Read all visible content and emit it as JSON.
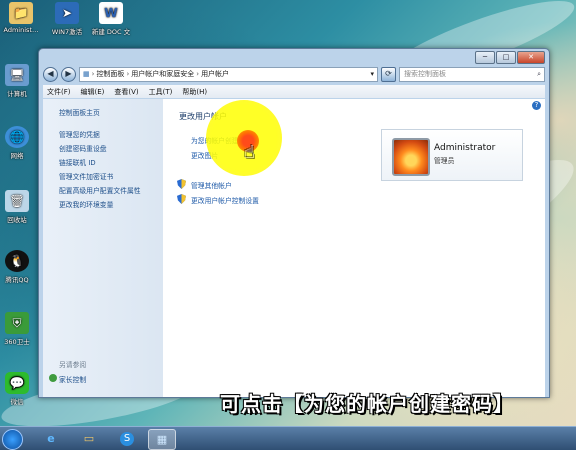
{
  "desktop": {
    "icons": [
      {
        "label": "Administ…",
        "icon": "user-folder-icon"
      },
      {
        "label": "WIN7激活",
        "icon": "activation-tool-icon"
      },
      {
        "label": "新建 DOC 文",
        "icon": "word-document-icon"
      },
      {
        "label": "计算机",
        "icon": "computer-icon"
      },
      {
        "label": "网络",
        "icon": "network-icon"
      },
      {
        "label": "回收站",
        "icon": "recycle-bin-icon"
      },
      {
        "label": "腾讯QQ",
        "icon": "qq-icon"
      },
      {
        "label": "360卫士",
        "icon": "360-security-icon"
      },
      {
        "label": "微信",
        "icon": "wechat-icon"
      }
    ]
  },
  "window": {
    "caption_min": "─",
    "caption_max": "□",
    "caption_close": "✕",
    "address": [
      "控制面板",
      "用户帐户和家庭安全",
      "用户帐户"
    ],
    "search_placeholder": "搜索控制面板",
    "menu": [
      "文件(F)",
      "编辑(E)",
      "查看(V)",
      "工具(T)",
      "帮助(H)"
    ],
    "help": "?"
  },
  "sidebar": {
    "links": [
      "控制面板主页",
      "管理您的凭据",
      "创建密码重设盘",
      "链接联机 ID",
      "管理文件加密证书",
      "配置高级用户配置文件属性",
      "更改我的环境变量"
    ],
    "see_also_title": "另请参阅",
    "see_also": [
      "家长控制"
    ]
  },
  "main": {
    "heading": "更改用户帐户",
    "links": [
      "为您的帐户创建密码",
      "更改图片"
    ],
    "shield_links": [
      "管理其他帐户",
      "更改用户帐户控制设置"
    ]
  },
  "user": {
    "name": "Administrator",
    "role": "管理员"
  },
  "overlay": {
    "subtitle": "可点击【为您的帐户创建密码】"
  },
  "taskbar": {
    "items": [
      "start-orb-icon",
      "ie-browser-icon",
      "file-explorer-icon",
      "sogou-input-icon",
      "control-panel-icon"
    ]
  }
}
